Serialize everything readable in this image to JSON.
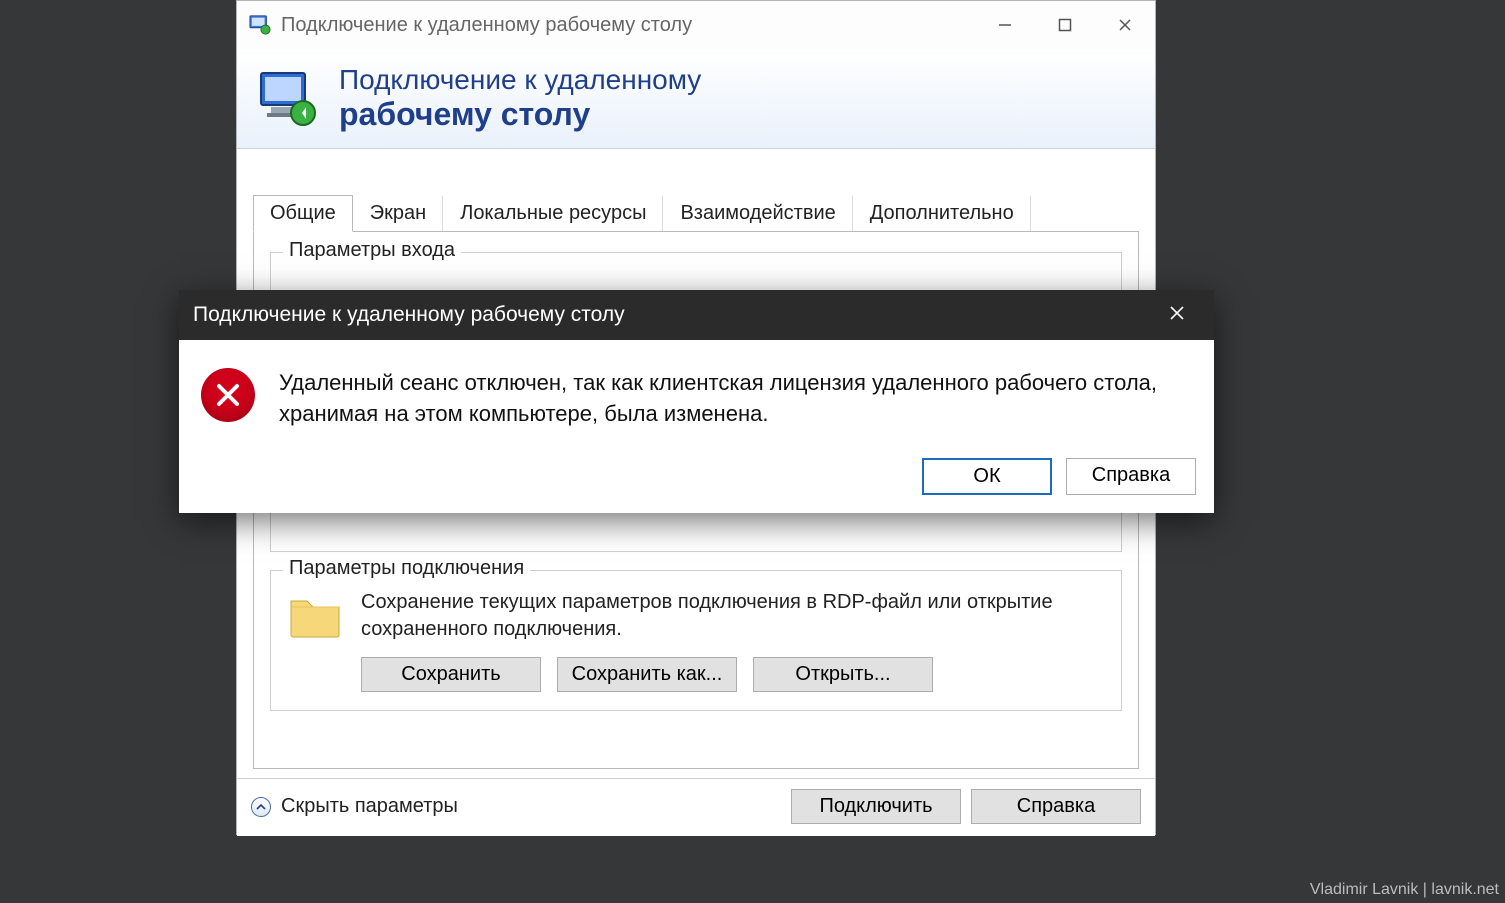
{
  "window": {
    "title": "Подключение к удаленному рабочему столу",
    "banner_line1": "Подключение к удаленному",
    "banner_line2": "рабочему столу"
  },
  "tabs": {
    "general": "Общие",
    "screen": "Экран",
    "local": "Локальные ресурсы",
    "experience": "Взаимодействие",
    "advanced": "Дополнительно"
  },
  "group_login": {
    "legend": "Параметры входа"
  },
  "group_conn": {
    "legend": "Параметры подключения",
    "text": "Сохранение текущих параметров подключения в RDP-файл или открытие сохраненного подключения.",
    "save": "Сохранить",
    "save_as": "Сохранить как...",
    "open": "Открыть..."
  },
  "footer": {
    "toggle": "Скрыть параметры",
    "connect": "Подключить",
    "help": "Справка"
  },
  "modal": {
    "title": "Подключение к удаленному рабочему столу",
    "message": "Удаленный сеанс отключен, так как клиентская лицензия удаленного рабочего стола, хранимая на этом компьютере, была изменена.",
    "ok": "ОК",
    "help": "Справка"
  },
  "watermark": "Vladimir Lavnik | lavnik.net"
}
